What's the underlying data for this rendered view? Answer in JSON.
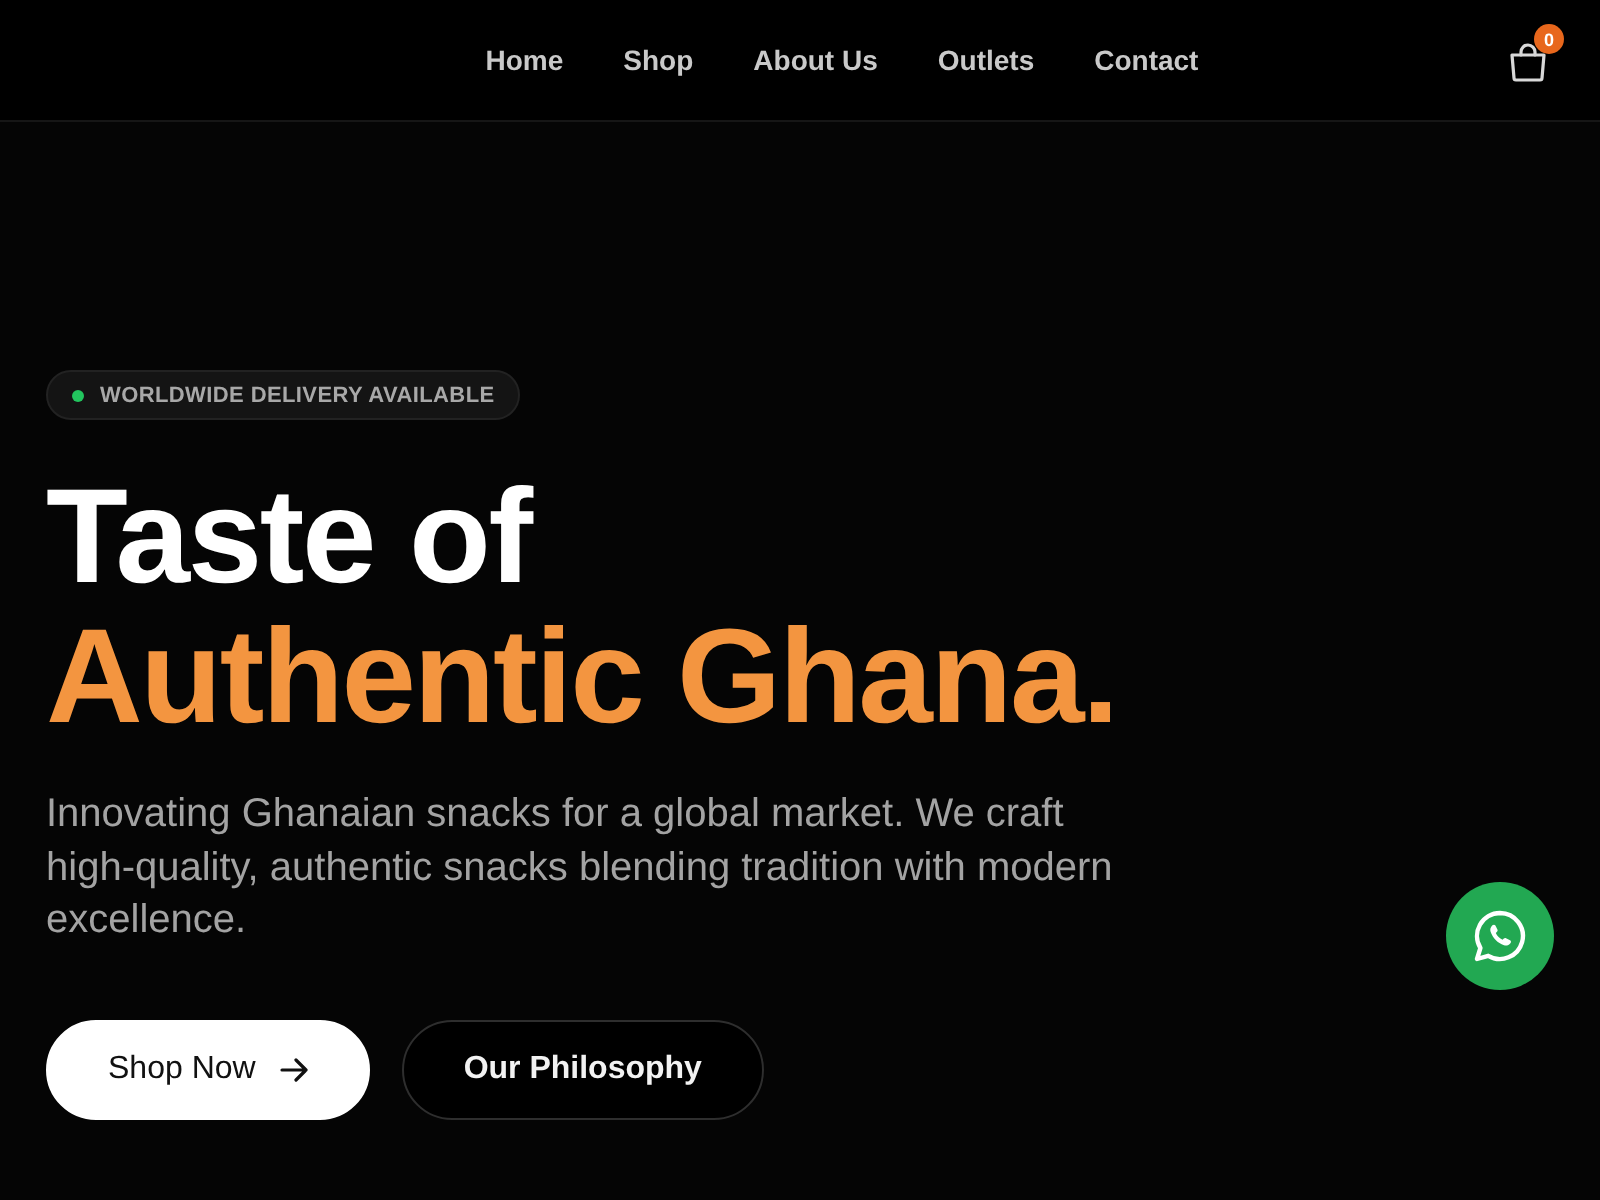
{
  "nav": {
    "links": [
      {
        "label": "Home"
      },
      {
        "label": "Shop"
      },
      {
        "label": "About Us"
      },
      {
        "label": "Outlets"
      },
      {
        "label": "Contact"
      }
    ],
    "cart": {
      "count": "0"
    }
  },
  "hero": {
    "badge": {
      "text": "WORLDWIDE DELIVERY AVAILABLE"
    },
    "headline": [
      {
        "text": "Taste of",
        "kind": "plain"
      },
      {
        "text": "Authentic Ghana.",
        "kind": "accent"
      }
    ],
    "description": "Innovating Ghanaian snacks for a global market. We craft high-quality, authentic snacks blending tradition with modern excellence.",
    "buttons": [
      {
        "label": "Shop Now",
        "kind": "primary"
      },
      {
        "label": "Our Philosophy",
        "kind": "outline"
      }
    ]
  }
}
